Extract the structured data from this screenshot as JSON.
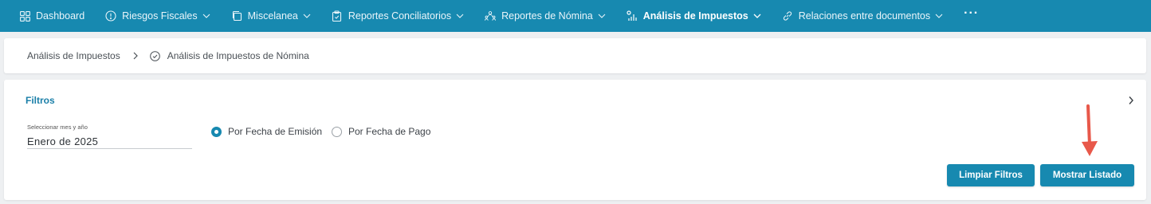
{
  "nav": {
    "items": [
      {
        "label": "Dashboard",
        "icon": "dashboard-grid-icon",
        "dropdown": false,
        "active": false
      },
      {
        "label": "Riesgos Fiscales",
        "icon": "alert-circle-icon",
        "dropdown": true,
        "active": false
      },
      {
        "label": "Miscelanea",
        "icon": "copy-icon",
        "dropdown": true,
        "active": false
      },
      {
        "label": "Reportes Conciliatorios",
        "icon": "clipboard-icon",
        "dropdown": true,
        "active": false
      },
      {
        "label": "Reportes de Nómina",
        "icon": "people-icon",
        "dropdown": true,
        "active": false
      },
      {
        "label": "Análisis de Impuestos",
        "icon": "bar-chart-icon",
        "dropdown": true,
        "active": true
      },
      {
        "label": "Relaciones entre documentos",
        "icon": "link-icon",
        "dropdown": true,
        "active": false
      }
    ],
    "more": "···",
    "bg_color": "#1789b0"
  },
  "breadcrumb": {
    "parent": "Análisis de Impuestos",
    "current": "Análisis de Impuestos de Nómina"
  },
  "filters": {
    "title": "Filtros",
    "date_label": "Seleccionar mes y año",
    "date_value": "Enero de 2025",
    "radio_emision": "Por Fecha de Emisión",
    "radio_pago": "Por Fecha de Pago",
    "selected": "emision",
    "clear_button": "Limpiar Filtros",
    "show_button": "Mostrar Listado"
  },
  "colors": {
    "accent": "#1789b0",
    "annotation_arrow": "#e8584a"
  }
}
